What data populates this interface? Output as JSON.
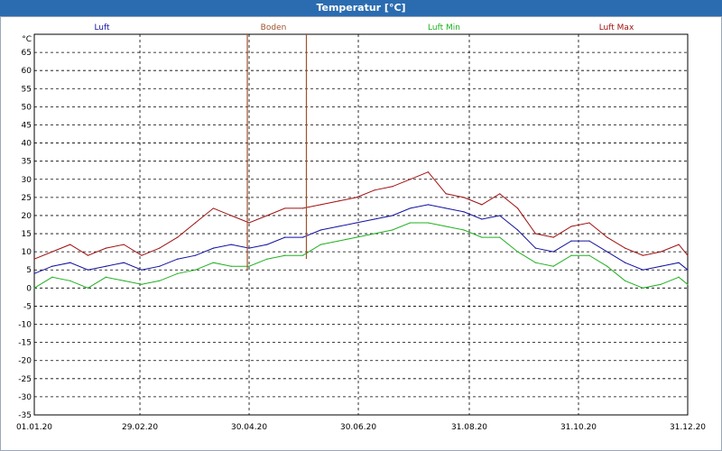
{
  "window": {
    "title": "Temperatur [°C]"
  },
  "chart_data": {
    "type": "line",
    "title": "Temperatur [°C]",
    "ylabel": "°C",
    "ylim": [
      -35,
      70
    ],
    "yticks": [
      65,
      60,
      55,
      50,
      45,
      40,
      35,
      30,
      25,
      20,
      15,
      10,
      5,
      0,
      -5,
      -10,
      -15,
      -20,
      -25,
      -30,
      -35
    ],
    "xlim_days": [
      0,
      365
    ],
    "xticks": [
      {
        "label": "01.01.20",
        "day": 0
      },
      {
        "label": "29.02.20",
        "day": 59
      },
      {
        "label": "30.04.20",
        "day": 120
      },
      {
        "label": "30.06.20",
        "day": 181
      },
      {
        "label": "31.08.20",
        "day": 243
      },
      {
        "label": "31.10.20",
        "day": 304
      },
      {
        "label": "31.12.20",
        "day": 365
      }
    ],
    "grid": true,
    "legend_position": "top",
    "x_days": [
      0,
      10,
      20,
      30,
      40,
      50,
      60,
      70,
      80,
      90,
      100,
      110,
      120,
      130,
      140,
      150,
      160,
      170,
      180,
      190,
      200,
      210,
      220,
      230,
      240,
      250,
      260,
      270,
      280,
      290,
      300,
      310,
      320,
      330,
      340,
      350,
      360,
      365
    ],
    "series": [
      {
        "name": "Luft",
        "color": "#1010a0",
        "values": [
          4,
          6,
          7,
          5,
          6,
          7,
          5,
          6,
          8,
          9,
          11,
          12,
          11,
          12,
          14,
          14,
          16,
          17,
          18,
          19,
          20,
          22,
          23,
          22,
          21,
          19,
          20,
          16,
          11,
          10,
          13,
          13,
          10,
          7,
          5,
          6,
          7,
          5
        ]
      },
      {
        "name": "Boden",
        "color": "#a0522d",
        "spikes": [
          {
            "day": 119,
            "top": 70,
            "bottom": 5
          },
          {
            "day": 152,
            "top": 70,
            "bottom": 8
          }
        ]
      },
      {
        "name": "Luft Min",
        "color": "#20b020",
        "values": [
          0,
          3,
          2,
          0,
          3,
          2,
          1,
          2,
          4,
          5,
          7,
          6,
          6,
          8,
          9,
          9,
          12,
          13,
          14,
          15,
          16,
          18,
          18,
          17,
          16,
          14,
          14,
          10,
          7,
          6,
          9,
          9,
          6,
          2,
          0,
          1,
          3,
          1
        ]
      },
      {
        "name": "Luft Max",
        "color": "#a01010",
        "values": [
          8,
          10,
          12,
          9,
          11,
          12,
          9,
          11,
          14,
          18,
          22,
          20,
          18,
          20,
          22,
          22,
          23,
          24,
          25,
          27,
          28,
          30,
          32,
          26,
          25,
          23,
          26,
          22,
          15,
          14,
          17,
          18,
          14,
          11,
          9,
          10,
          12,
          9
        ]
      }
    ]
  }
}
